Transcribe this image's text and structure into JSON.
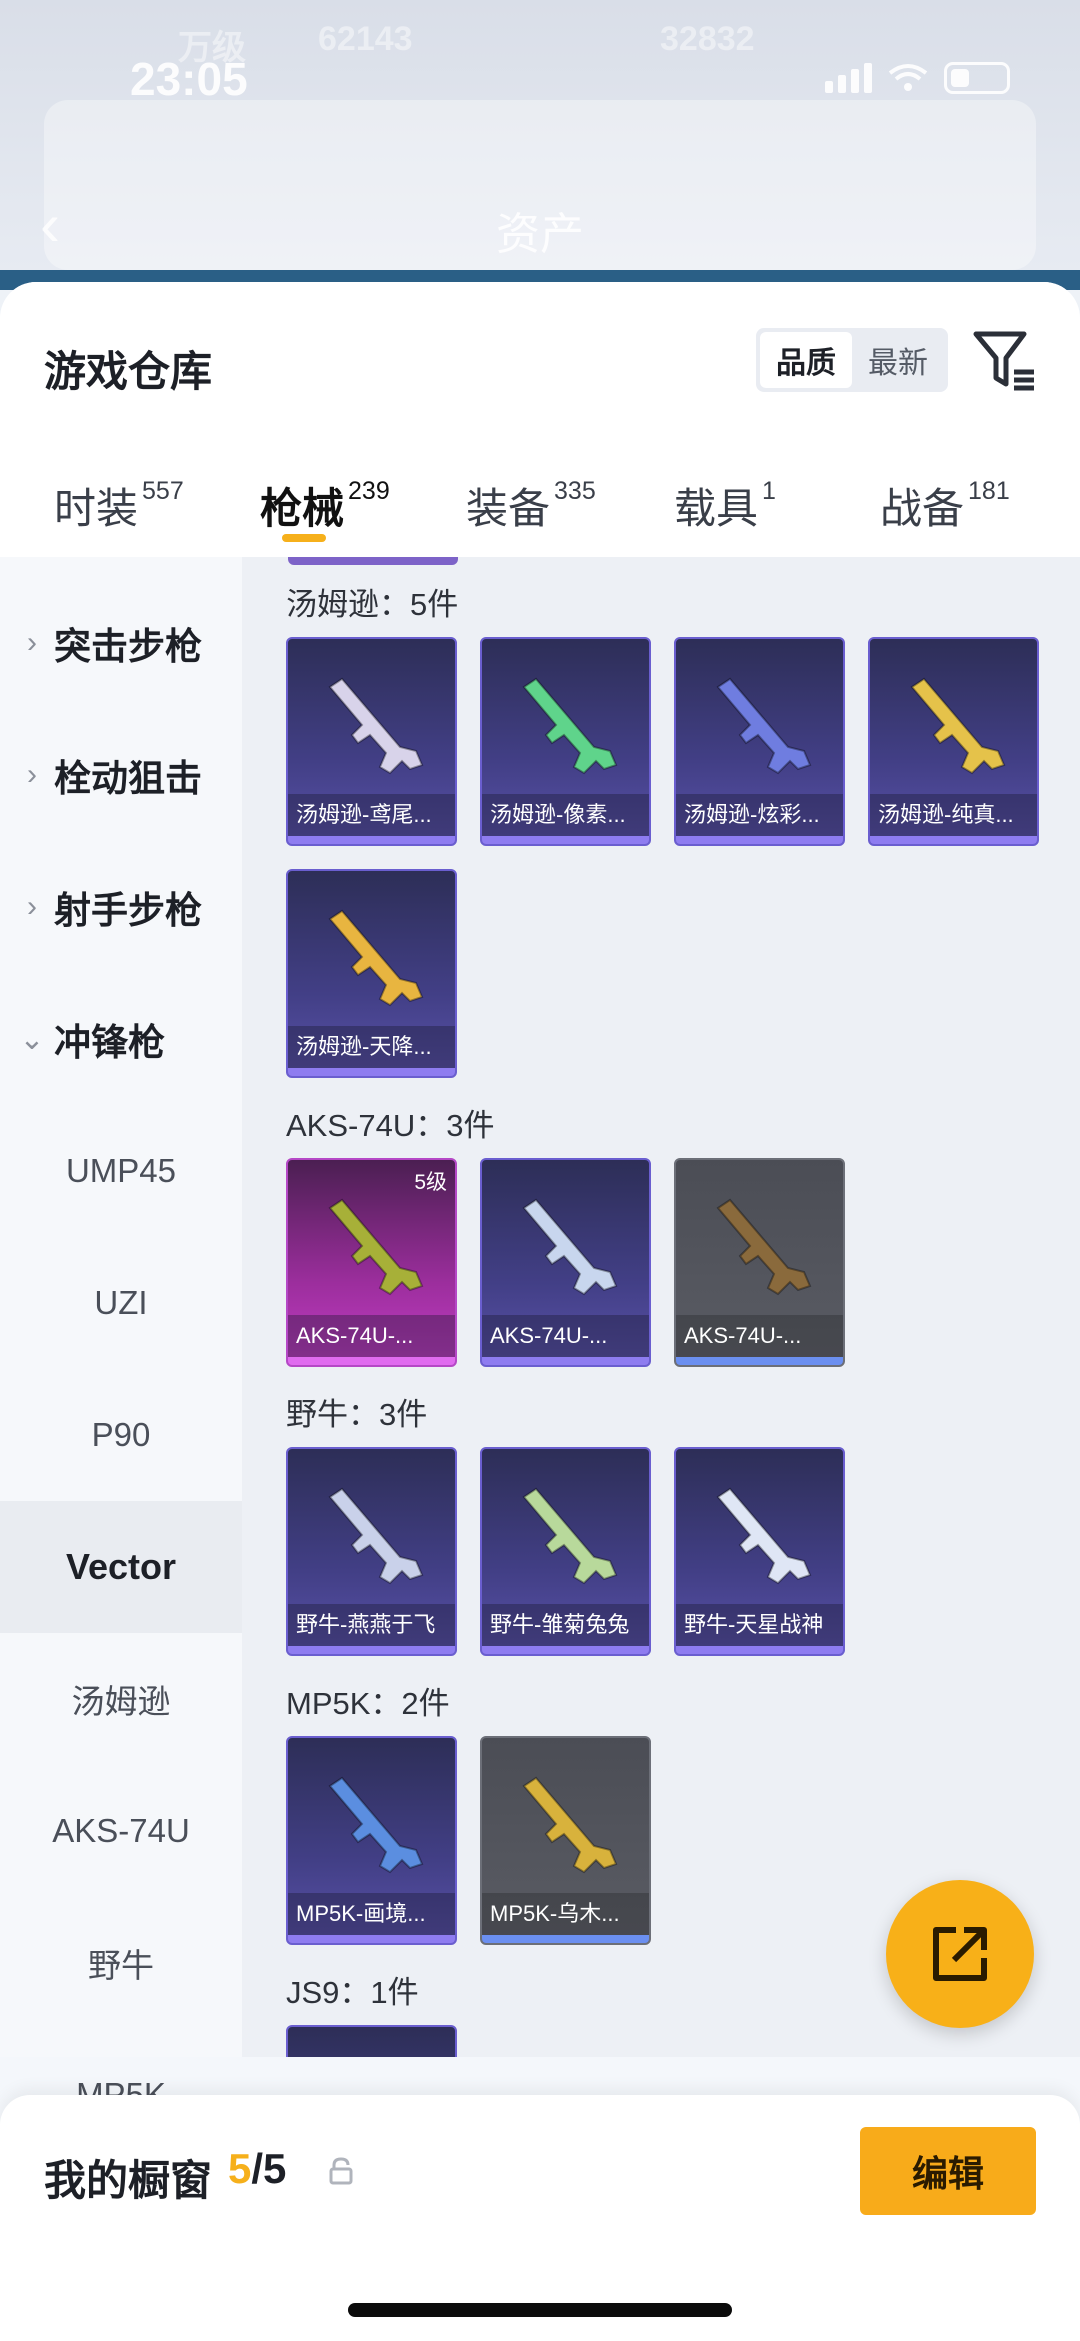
{
  "status_bar": {
    "time": "23:05",
    "bg_text_a": "万级",
    "bg_text_b": "62143",
    "bg_text_c": "32832"
  },
  "background": {
    "title": "资产"
  },
  "sheet": {
    "title": "游戏仓库",
    "sort_options": [
      "品质",
      "最新"
    ],
    "tabs": [
      {
        "label": "时装",
        "count": "557"
      },
      {
        "label": "枪械",
        "count": "239"
      },
      {
        "label": "装备",
        "count": "335"
      },
      {
        "label": "载具",
        "count": "1"
      },
      {
        "label": "战备",
        "count": "181"
      }
    ]
  },
  "categories": [
    {
      "label": "突击步枪",
      "chev": "›",
      "type": "group"
    },
    {
      "label": "栓动狙击",
      "chev": "›",
      "type": "group"
    },
    {
      "label": "射手步枪",
      "chev": "›",
      "type": "group"
    },
    {
      "label": "冲锋枪",
      "chev": "⌄",
      "type": "group"
    },
    {
      "label": "UMP45",
      "type": "sub"
    },
    {
      "label": "UZI",
      "type": "sub"
    },
    {
      "label": "P90",
      "type": "sub"
    },
    {
      "label": "Vector",
      "type": "sub",
      "active": true
    },
    {
      "label": "汤姆逊",
      "type": "sub"
    },
    {
      "label": "AKS-74U",
      "type": "sub"
    },
    {
      "label": "野牛",
      "type": "sub"
    },
    {
      "label": "MP5K",
      "type": "sub"
    }
  ],
  "sections": [
    {
      "title": "汤姆逊：5件",
      "items": [
        {
          "name": "汤姆逊-鸢尾...",
          "style": "purple",
          "gun_color": "#d8d3ea"
        },
        {
          "name": "汤姆逊-像素...",
          "style": "purple",
          "gun_color": "#5fd48b"
        },
        {
          "name": "汤姆逊-炫彩...",
          "style": "purple",
          "gun_color": "#6f7de0"
        },
        {
          "name": "汤姆逊-纯真...",
          "style": "purple",
          "gun_color": "#e5c24a"
        },
        {
          "name": "汤姆逊-天降...",
          "style": "purple",
          "gun_color": "#e8b540"
        }
      ]
    },
    {
      "title": "AKS-74U：3件",
      "items": [
        {
          "name": "AKS-74U-...",
          "style": "pink",
          "gun_color": "#a7b038",
          "level": "5级"
        },
        {
          "name": "AKS-74U-...",
          "style": "purple",
          "gun_color": "#c8d6ee"
        },
        {
          "name": "AKS-74U-...",
          "style": "gray",
          "gun_color": "#8a6a3c"
        }
      ]
    },
    {
      "title": "野牛：3件",
      "items": [
        {
          "name": "野牛-燕燕于飞",
          "style": "purple",
          "gun_color": "#c9d1ea"
        },
        {
          "name": "野牛-雏菊兔兔",
          "style": "purple",
          "gun_color": "#b8d99b"
        },
        {
          "name": "野牛-天星战神",
          "style": "purple",
          "gun_color": "#dfe6f5"
        }
      ]
    },
    {
      "title": "MP5K：2件",
      "items": [
        {
          "name": "MP5K-画境...",
          "style": "purple",
          "gun_color": "#5b8ee0"
        },
        {
          "name": "MP5K-乌木...",
          "style": "gray",
          "gun_color": "#d8b23c"
        }
      ]
    },
    {
      "title": "JS9：1件",
      "items": [
        {
          "name": "",
          "style": "purple",
          "gun_color": "#c8d6ee"
        }
      ]
    }
  ],
  "bottom_bar": {
    "label": "我的橱窗",
    "count_current": "5",
    "count_total": "/5",
    "edit_label": "编辑"
  },
  "colors": {
    "accent": "#f6b01b",
    "card_purple": "#423f86",
    "card_pink": "#9c2e9d",
    "card_gray": "#5a5c64"
  }
}
